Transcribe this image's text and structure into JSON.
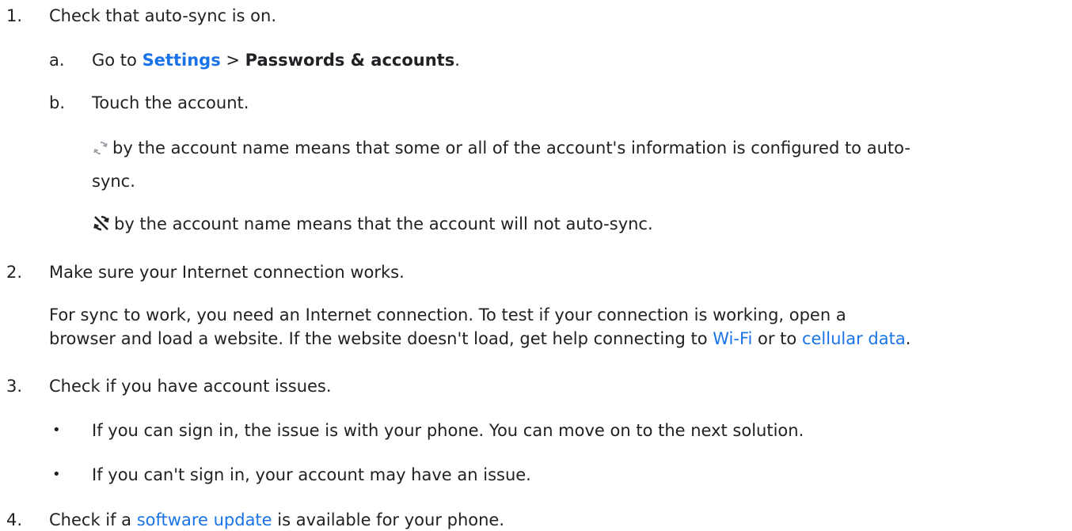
{
  "steps": [
    {
      "num": "1.",
      "text": "Check that auto-sync is on.",
      "substeps": [
        {
          "marker": "a.",
          "pre": "Go to ",
          "link": "Settings",
          "sep": " > ",
          "bold": "Passwords & accounts",
          "post": "."
        },
        {
          "marker": "b.",
          "text": "Touch the account."
        }
      ],
      "notes": {
        "sync_on_line1": "by the account name means that some or all of the account's information is configured to auto-",
        "sync_on_line2": "sync.",
        "sync_off": "by the account name means that the account will not auto-sync.",
        "sync_on_icon": "sync-icon",
        "sync_off_icon": "sync-off-icon"
      }
    },
    {
      "num": "2.",
      "text": "Make sure your Internet connection works.",
      "para_line1": "For sync to work, you need an Internet connection. To test if your connection is working, open a",
      "para_line2_pre": "browser and load a website. If the website doesn't load, get help connecting to ",
      "wifi_link": "Wi-Fi",
      "para_line2_mid": " or to ",
      "cellular_link": "cellular data",
      "para_line2_post": "."
    },
    {
      "num": "3.",
      "text": "Check if you have account issues.",
      "bullets": [
        "If you can sign in, the issue is with your phone. You can move on to the next solution.",
        "If you can't sign in, your account may have an issue."
      ]
    },
    {
      "num": "4.",
      "pre": "Check if a ",
      "link": "software update",
      "post": " is available for your phone."
    }
  ],
  "colors": {
    "text": "#202124",
    "link": "#1a73e8",
    "icon_on": "#9aa0a6",
    "icon_off": "#202124"
  }
}
